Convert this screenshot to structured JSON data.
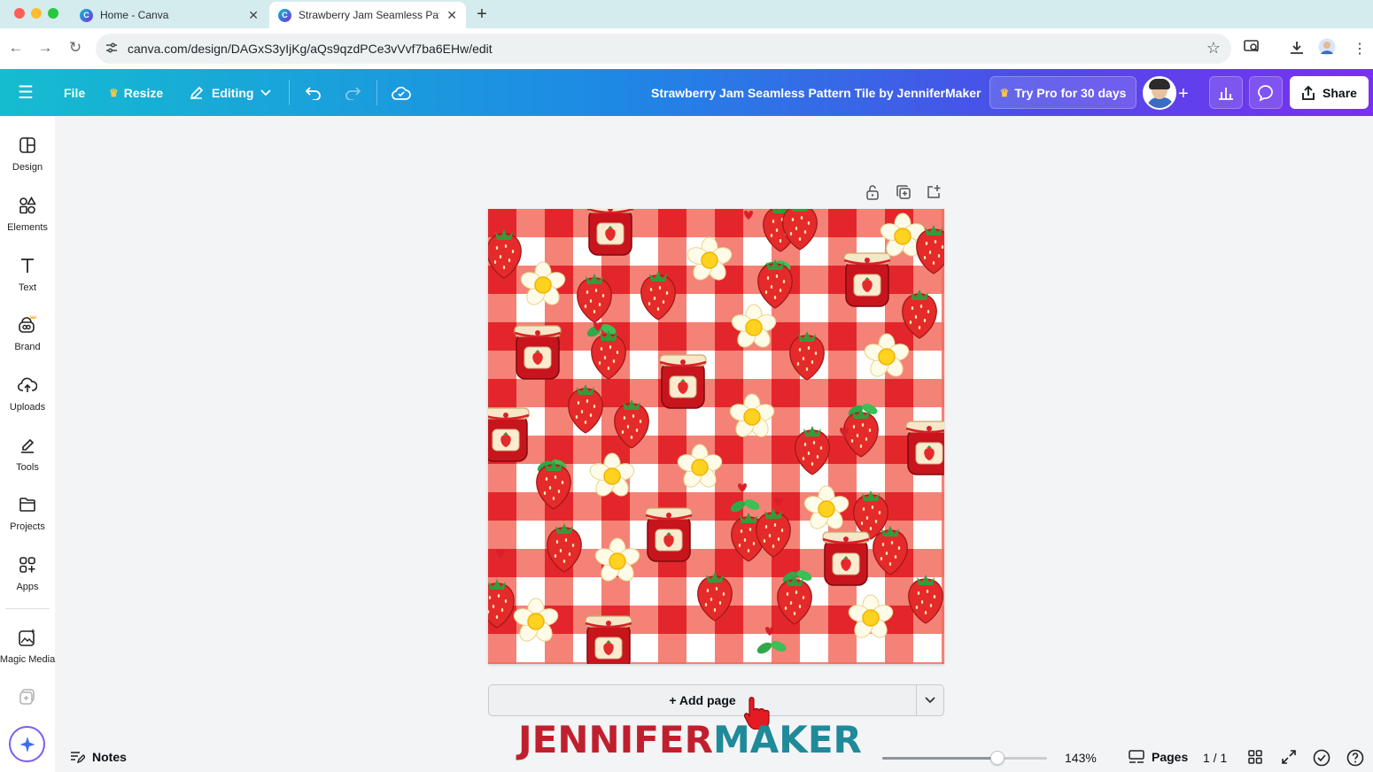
{
  "browser": {
    "tabs": [
      {
        "title": "Home - Canva",
        "active": false
      },
      {
        "title": "Strawberry Jam Seamless Pat",
        "active": true
      }
    ],
    "url": "canva.com/design/DAGxS3yIjKg/aQs9qzdPCe3vVvf7ba6EHw/edit"
  },
  "header": {
    "file_label": "File",
    "resize_label": "Resize",
    "editing_label": "Editing",
    "doc_title": "Strawberry Jam Seamless Pattern Tile by JenniferMaker",
    "try_pro_label": "Try Pro for 30 days",
    "share_label": "Share"
  },
  "sidebar": {
    "items": [
      {
        "label": "Design",
        "icon": "design-icon"
      },
      {
        "label": "Elements",
        "icon": "elements-icon"
      },
      {
        "label": "Text",
        "icon": "text-icon"
      },
      {
        "label": "Brand",
        "icon": "brand-icon"
      },
      {
        "label": "Uploads",
        "icon": "uploads-icon"
      },
      {
        "label": "Tools",
        "icon": "tools-icon"
      },
      {
        "label": "Projects",
        "icon": "projects-icon"
      },
      {
        "label": "Apps",
        "icon": "apps-icon"
      },
      {
        "label": "Magic Media",
        "icon": "magic-media-icon"
      }
    ]
  },
  "canvas": {
    "add_page_label": "+ Add page",
    "watermark_part1": "JENNIFER",
    "watermark_part2": "MAKER"
  },
  "footer": {
    "notes_label": "Notes",
    "zoom_label": "143%",
    "zoom_fraction": 0.7,
    "pages_label": "Pages",
    "page_count": "1 / 1"
  },
  "colors": {
    "gingham_red": "#e8322e",
    "gingham_mid": "#f4796b",
    "brand_red": "#c0202e",
    "brand_teal": "#1f8a99"
  }
}
